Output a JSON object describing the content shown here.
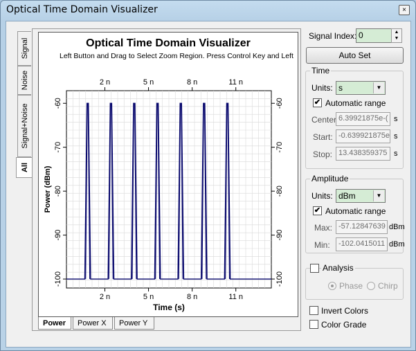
{
  "window": {
    "title": "Optical Time Domain Visualizer",
    "close_glyph": "×"
  },
  "side_tabs": [
    "Signal",
    "Noise",
    "Signal+Noise",
    "All"
  ],
  "bottom_tabs": [
    "Power",
    "Power X",
    "Power Y"
  ],
  "chart_data": {
    "type": "line",
    "title": "Optical Time Domain Visualizer",
    "subtitle": "Left Button and Drag to Select Zoom Region. Press Control Key and Left",
    "xlabel": "Time (s)",
    "ylabel": "Power (dBm)",
    "x_tick_labels": [
      "2 n",
      "5 n",
      "8 n",
      "11 n"
    ],
    "x_ticks": [
      2,
      5,
      8,
      11
    ],
    "xlim": [
      -0.64,
      13.44
    ],
    "x_unit": "ns",
    "y_tick_labels": [
      "-60",
      "-70",
      "-80",
      "-90",
      "-100"
    ],
    "y_ticks": [
      -60,
      -70,
      -80,
      -90,
      -100
    ],
    "ylim": [
      -102.04,
      -57.13
    ],
    "grid": true,
    "series_color": "#0a0a6e",
    "pulses": [
      {
        "center": 0.82,
        "peak": -60,
        "floor": -100
      },
      {
        "center": 2.42,
        "peak": -60,
        "floor": -100
      },
      {
        "center": 4.02,
        "peak": -60,
        "floor": -100
      },
      {
        "center": 5.62,
        "peak": -60,
        "floor": -100
      },
      {
        "center": 7.22,
        "peak": -60,
        "floor": -100
      },
      {
        "center": 8.82,
        "peak": -60,
        "floor": -100
      },
      {
        "center": 10.42,
        "peak": -60,
        "floor": -100
      }
    ]
  },
  "signal_index": {
    "label": "Signal Index:",
    "value": "0"
  },
  "auto_set_label": "Auto Set",
  "time_group": {
    "title": "Time",
    "units_label": "Units:",
    "units_value": "s",
    "auto_range_label": "Automatic range",
    "auto_range_checked": true,
    "center_label": "Center:",
    "center_value": "6.39921875e-(",
    "start_label": "Start:",
    "start_value": "-0.639921875e",
    "stop_label": "Stop:",
    "stop_value": "13.438359375",
    "unit": "s"
  },
  "amplitude_group": {
    "title": "Amplitude",
    "units_label": "Units:",
    "units_value": "dBm",
    "auto_range_label": "Automatic range",
    "auto_range_checked": true,
    "max_label": "Max:",
    "max_value": "-57.12847639",
    "min_label": "Min:",
    "min_value": "-102.0415011",
    "unit": "dBm"
  },
  "analysis_group": {
    "title": "Analysis",
    "phase_label": "Phase",
    "chirp_label": "Chirp"
  },
  "invert_colors_label": "Invert Colors",
  "color_grade_label": "Color Grade",
  "check_glyph": "✔",
  "dropdown_glyph": "▼",
  "spin_up_glyph": "▲",
  "spin_down_glyph": "▼"
}
